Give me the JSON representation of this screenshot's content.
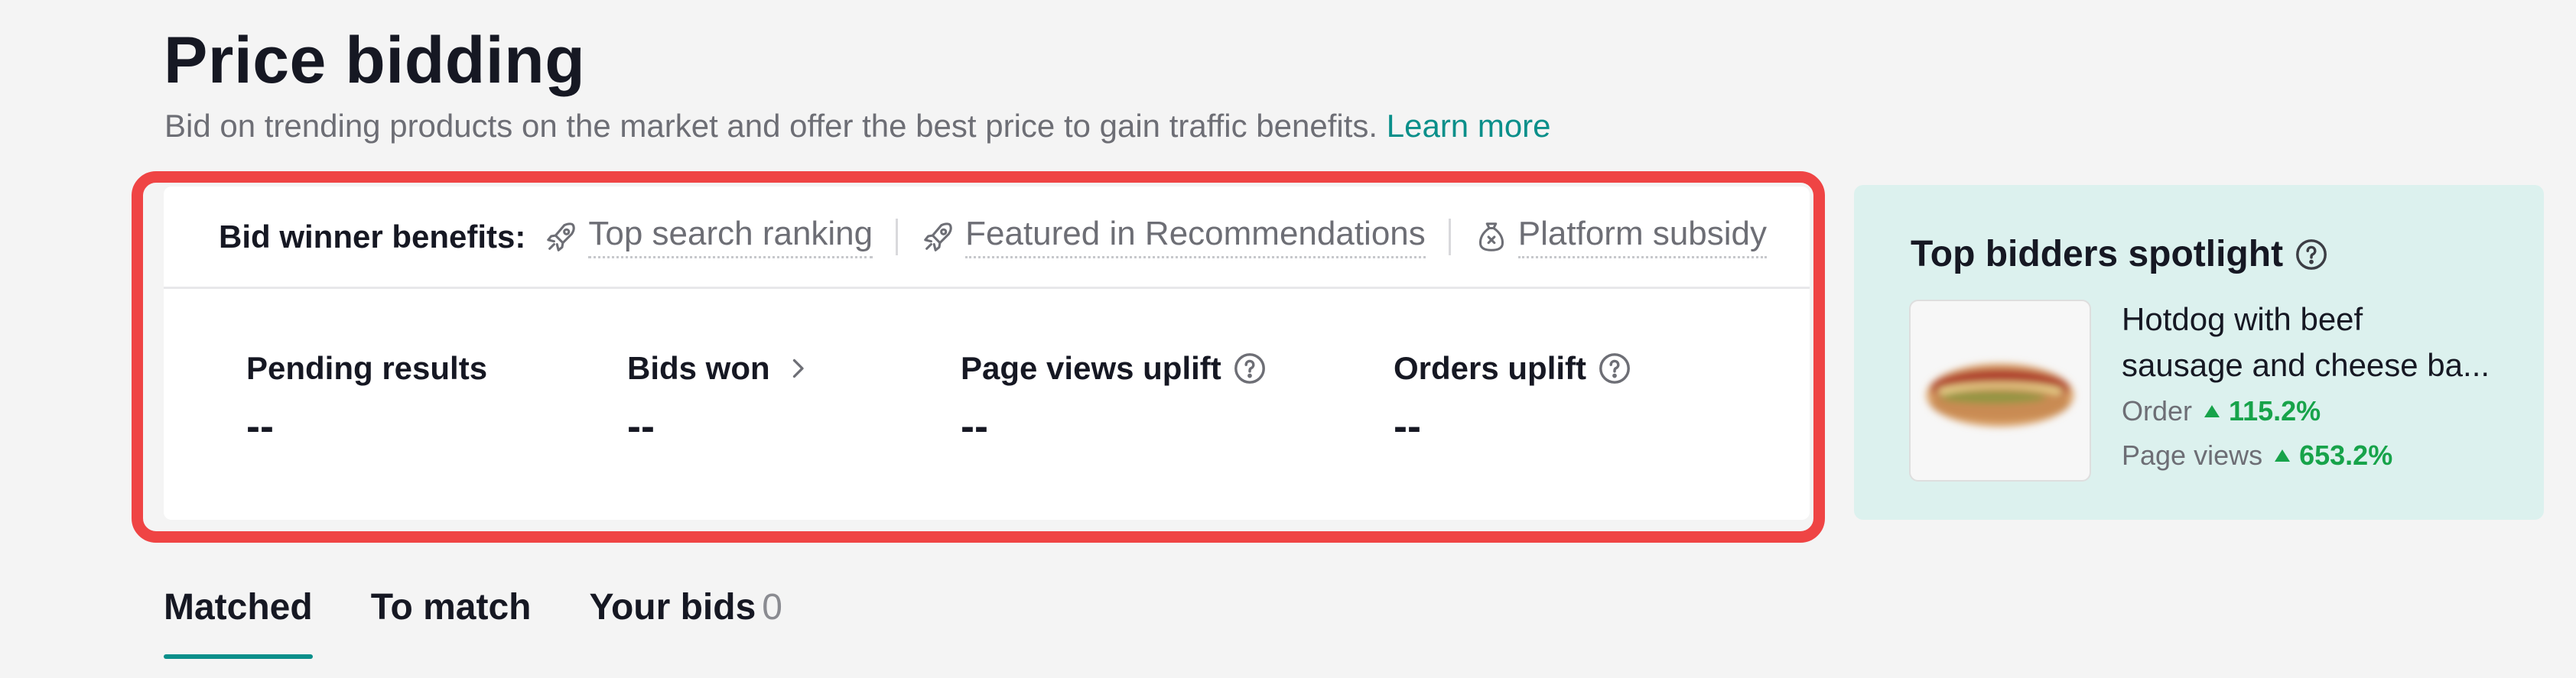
{
  "header": {
    "title": "Price bidding",
    "subtitle": "Bid on trending products on the market and offer the best price to gain traffic benefits.",
    "learn_more": "Learn more"
  },
  "benefits": {
    "label": "Bid winner benefits:",
    "items": [
      {
        "icon": "rocket-icon",
        "label": "Top search ranking"
      },
      {
        "icon": "rocket-icon",
        "label": "Featured in Recommendations"
      },
      {
        "icon": "money-bag-icon",
        "label": "Platform subsidy"
      }
    ]
  },
  "metrics": [
    {
      "label": "Pending results",
      "value": "--"
    },
    {
      "label": "Bids won",
      "value": "--",
      "icon": "chevron-right-icon"
    },
    {
      "label": "Page views uplift",
      "value": "--",
      "icon": "help-icon"
    },
    {
      "label": "Orders uplift",
      "value": "--",
      "icon": "help-icon"
    }
  ],
  "spotlight": {
    "title": "Top bidders spotlight",
    "product_line1": "Hotdog with beef",
    "product_line2": "sausage and cheese ba...",
    "order_label": "Order",
    "order_value": "115.2%",
    "pageviews_label": "Page views",
    "pageviews_value": "653.2%"
  },
  "tabs": [
    {
      "label": "Matched",
      "active": true
    },
    {
      "label": "To match"
    },
    {
      "label": "Your bids",
      "count": "0"
    }
  ],
  "colors": {
    "accent": "#0a8f8a",
    "highlight": "#ef4444",
    "uplift": "#17a34a",
    "spotlight_bg": "#dcf1ee"
  }
}
